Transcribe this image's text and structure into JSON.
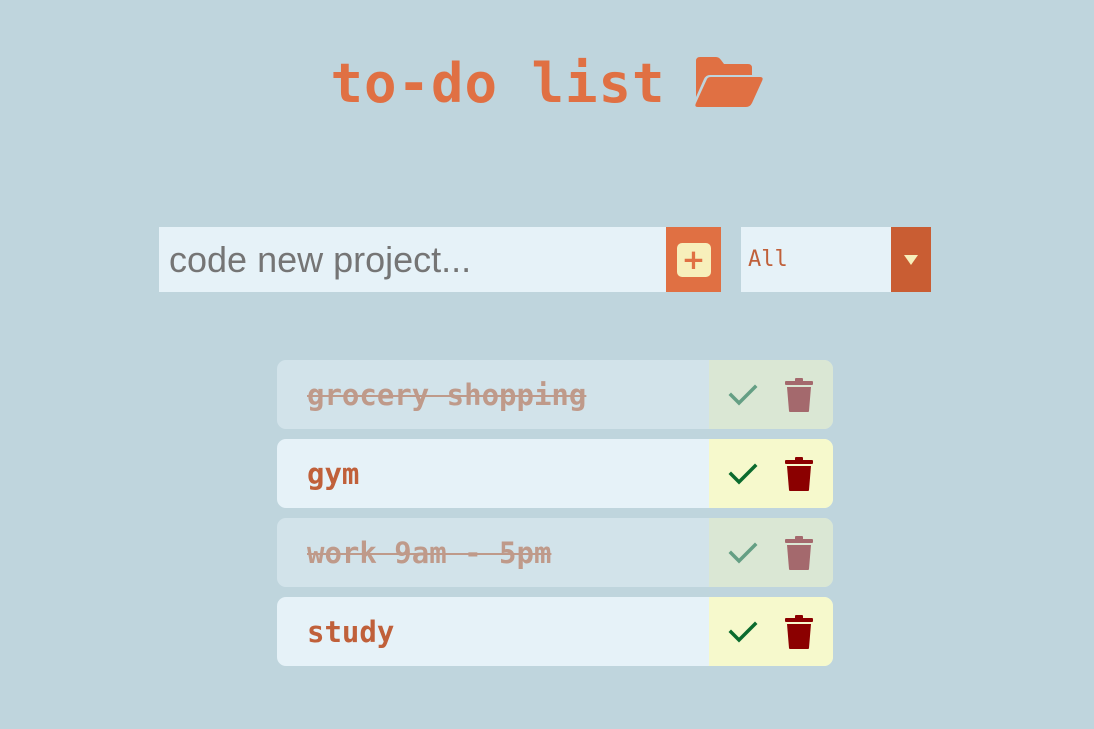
{
  "header": {
    "title": "to-do list",
    "icon": "folder-open-icon"
  },
  "form": {
    "input_value": "",
    "input_placeholder": "code new project...",
    "add_icon": "plus-icon",
    "filter_selected": "All",
    "filter_icon": "caret-down-icon"
  },
  "todos": [
    {
      "text": "grocery shopping",
      "completed": true
    },
    {
      "text": "gym",
      "completed": false
    },
    {
      "text": "work 9am - 5pm",
      "completed": true
    },
    {
      "text": "study",
      "completed": false
    }
  ],
  "colors": {
    "background": "#bfd5dd",
    "accent": "#e07043",
    "accent_dark": "#c95d33",
    "item_bg": "#e6f2f8",
    "actions_bg": "#f6f9cc",
    "check": "#0b6b2e",
    "trash": "#8b0000"
  }
}
